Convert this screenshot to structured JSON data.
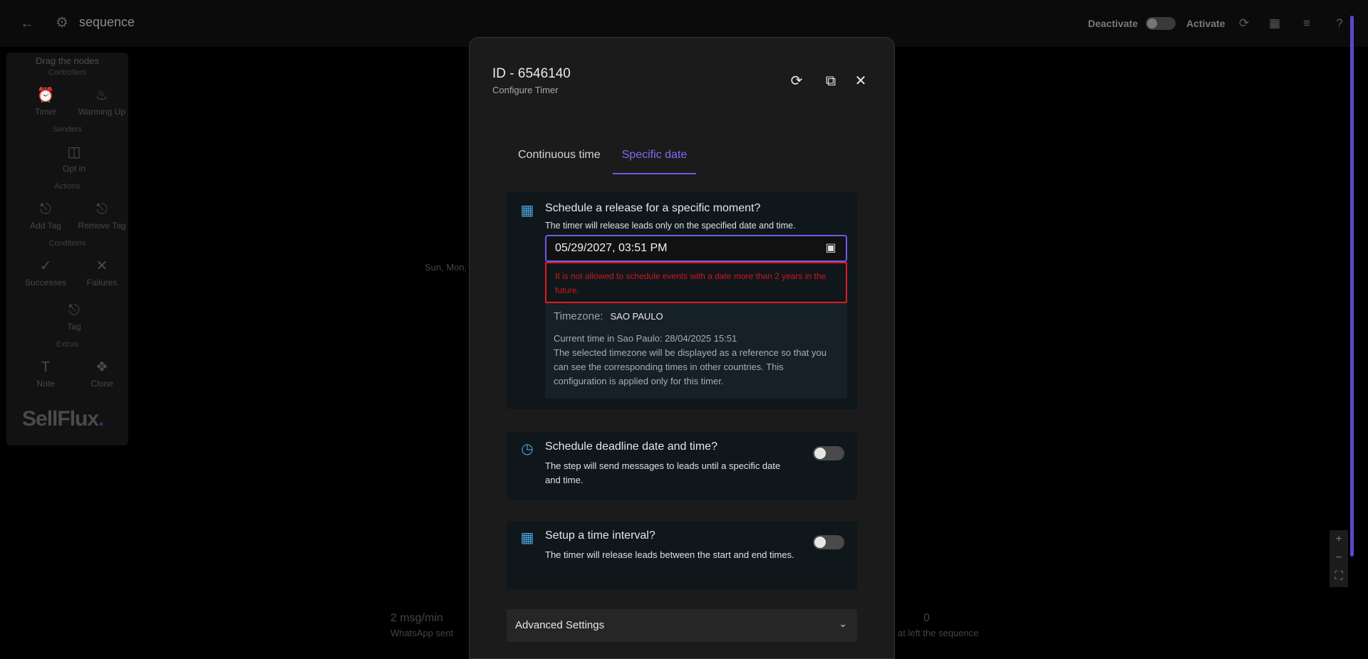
{
  "topbar": {
    "title": "sequence",
    "deactivate_label": "Deactivate",
    "activate_label": "Activate"
  },
  "palette": {
    "header": "Drag the nodes",
    "sections": {
      "controllers": "Controllers",
      "senders": "Senders",
      "actions": "Actions",
      "conditions": "Conditions",
      "extras": "Extras"
    },
    "nodes": {
      "timer": "Timer",
      "warming_up": "Warming Up",
      "opt_in": "Opt in",
      "add_tag": "Add Tag",
      "remove_tag": "Remove Tag",
      "successes": "Successes",
      "failures": "Failures",
      "tag": "Tag",
      "note": "Note",
      "clone": "Clone"
    },
    "logo_main": "SellFlux",
    "logo_dot": "."
  },
  "canvas": {
    "days_text": "Sun, Mon,",
    "stat_whatsapp_value": "2 msg/min",
    "stat_whatsapp_label": "WhatsApp sent",
    "stat_left_value": "0",
    "stat_left_label": "at left the sequence"
  },
  "modal": {
    "id_text": "ID - 6546140",
    "subtitle": "Configure Timer",
    "tabs": [
      "Continuous time",
      "Specific date"
    ],
    "active_tab": "Specific date",
    "specific": {
      "title": "Schedule a release for a specific moment?",
      "description": "The timer will release leads only on the specified date and time.",
      "datetime_value": "05/29/2027, 03:51 PM",
      "error": "It is not allowed to schedule events with a date more than 2 years in the future.",
      "timezone_label": "Timezone:",
      "timezone_value": "SAO PAULO",
      "current_time": "Current time in Sao Paulo: 28/04/2025 15:51",
      "timezone_note": "The selected timezone will be displayed as a reference so that you can see the corresponding times in other countries. This configuration is applied only for this timer."
    },
    "deadline": {
      "title": "Schedule deadline date and time?",
      "description": "The step will send messages to leads until a specific date and time.",
      "enabled": false
    },
    "interval": {
      "title": "Setup a time interval?",
      "description": "The timer will release leads between the start and end times.",
      "enabled": false
    },
    "advanced_label": "Advanced Settings"
  },
  "colors": {
    "accent": "#6c5ce7",
    "error": "#e01b24",
    "icon_blue": "#4ca3dc"
  },
  "icons": {
    "back": "arrow-left-icon",
    "gear": "gear-icon",
    "refresh": "refresh-icon",
    "map": "map-icon",
    "search_list": "search-list-icon",
    "help": "help-icon",
    "reset": "reset-icon",
    "copy": "copy-icon",
    "close": "close-icon",
    "calendar": "calendar-icon",
    "clock": "clock-icon",
    "calendar_interval": "calendar-interval-icon",
    "chevron": "chevron-down-icon"
  }
}
